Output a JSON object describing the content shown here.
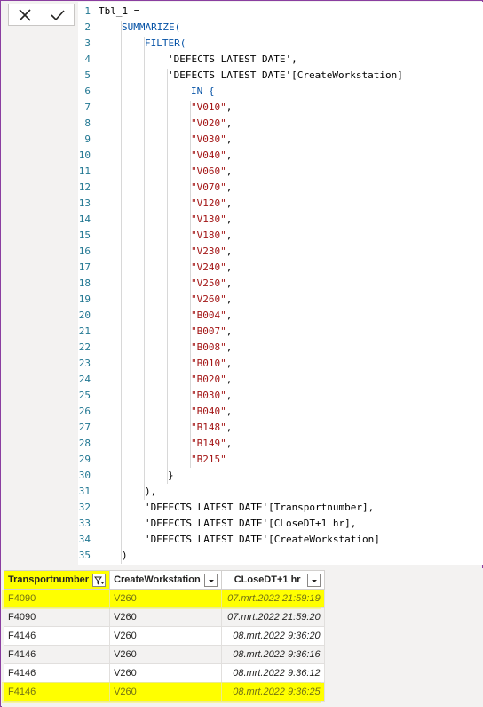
{
  "formula_bar": {
    "cancel_icon": "close-icon",
    "commit_icon": "checkmark-icon"
  },
  "editor": {
    "lines": [
      {
        "n": "1",
        "indent": 0,
        "parts": [
          {
            "t": "Tbl_1 =",
            "c": "plain"
          }
        ]
      },
      {
        "n": "2",
        "indent": 1,
        "parts": [
          {
            "t": "SUMMARIZE(",
            "c": "kw"
          }
        ]
      },
      {
        "n": "3",
        "indent": 2,
        "parts": [
          {
            "t": "FILTER(",
            "c": "kw"
          }
        ]
      },
      {
        "n": "4",
        "indent": 3,
        "parts": [
          {
            "t": "'DEFECTS LATEST DATE',",
            "c": "plain"
          }
        ]
      },
      {
        "n": "5",
        "indent": 3,
        "parts": [
          {
            "t": "'DEFECTS LATEST DATE'[CreateWorkstation]",
            "c": "plain"
          }
        ]
      },
      {
        "n": "6",
        "indent": 4,
        "parts": [
          {
            "t": "IN {",
            "c": "kw"
          }
        ]
      },
      {
        "n": "7",
        "indent": 4,
        "parts": [
          {
            "t": "\"V010\"",
            "c": "str"
          },
          {
            "t": ",",
            "c": "plain"
          }
        ]
      },
      {
        "n": "8",
        "indent": 4,
        "parts": [
          {
            "t": "\"V020\"",
            "c": "str"
          },
          {
            "t": ",",
            "c": "plain"
          }
        ]
      },
      {
        "n": "9",
        "indent": 4,
        "parts": [
          {
            "t": "\"V030\"",
            "c": "str"
          },
          {
            "t": ",",
            "c": "plain"
          }
        ]
      },
      {
        "n": "10",
        "indent": 4,
        "parts": [
          {
            "t": "\"V040\"",
            "c": "str"
          },
          {
            "t": ",",
            "c": "plain"
          }
        ]
      },
      {
        "n": "11",
        "indent": 4,
        "parts": [
          {
            "t": "\"V060\"",
            "c": "str"
          },
          {
            "t": ",",
            "c": "plain"
          }
        ]
      },
      {
        "n": "12",
        "indent": 4,
        "parts": [
          {
            "t": "\"V070\"",
            "c": "str"
          },
          {
            "t": ",",
            "c": "plain"
          }
        ]
      },
      {
        "n": "13",
        "indent": 4,
        "parts": [
          {
            "t": "\"V120\"",
            "c": "str"
          },
          {
            "t": ",",
            "c": "plain"
          }
        ]
      },
      {
        "n": "14",
        "indent": 4,
        "parts": [
          {
            "t": "\"V130\"",
            "c": "str"
          },
          {
            "t": ",",
            "c": "plain"
          }
        ]
      },
      {
        "n": "15",
        "indent": 4,
        "parts": [
          {
            "t": "\"V180\"",
            "c": "str"
          },
          {
            "t": ",",
            "c": "plain"
          }
        ]
      },
      {
        "n": "16",
        "indent": 4,
        "parts": [
          {
            "t": "\"V230\"",
            "c": "str"
          },
          {
            "t": ",",
            "c": "plain"
          }
        ]
      },
      {
        "n": "17",
        "indent": 4,
        "parts": [
          {
            "t": "\"V240\"",
            "c": "str"
          },
          {
            "t": ",",
            "c": "plain"
          }
        ]
      },
      {
        "n": "18",
        "indent": 4,
        "parts": [
          {
            "t": "\"V250\"",
            "c": "str"
          },
          {
            "t": ",",
            "c": "plain"
          }
        ]
      },
      {
        "n": "19",
        "indent": 4,
        "parts": [
          {
            "t": "\"V260\"",
            "c": "str"
          },
          {
            "t": ",",
            "c": "plain"
          }
        ]
      },
      {
        "n": "20",
        "indent": 4,
        "parts": [
          {
            "t": "\"B004\"",
            "c": "str"
          },
          {
            "t": ",",
            "c": "plain"
          }
        ]
      },
      {
        "n": "21",
        "indent": 4,
        "parts": [
          {
            "t": "\"B007\"",
            "c": "str"
          },
          {
            "t": ",",
            "c": "plain"
          }
        ]
      },
      {
        "n": "22",
        "indent": 4,
        "parts": [
          {
            "t": "\"B008\"",
            "c": "str"
          },
          {
            "t": ",",
            "c": "plain"
          }
        ]
      },
      {
        "n": "23",
        "indent": 4,
        "parts": [
          {
            "t": "\"B010\"",
            "c": "str"
          },
          {
            "t": ",",
            "c": "plain"
          }
        ]
      },
      {
        "n": "24",
        "indent": 4,
        "parts": [
          {
            "t": "\"B020\"",
            "c": "str"
          },
          {
            "t": ",",
            "c": "plain"
          }
        ]
      },
      {
        "n": "25",
        "indent": 4,
        "parts": [
          {
            "t": "\"B030\"",
            "c": "str"
          },
          {
            "t": ",",
            "c": "plain"
          }
        ]
      },
      {
        "n": "26",
        "indent": 4,
        "parts": [
          {
            "t": "\"B040\"",
            "c": "str"
          },
          {
            "t": ",",
            "c": "plain"
          }
        ]
      },
      {
        "n": "27",
        "indent": 4,
        "parts": [
          {
            "t": "\"B148\"",
            "c": "str"
          },
          {
            "t": ",",
            "c": "plain"
          }
        ]
      },
      {
        "n": "28",
        "indent": 4,
        "parts": [
          {
            "t": "\"B149\"",
            "c": "str"
          },
          {
            "t": ",",
            "c": "plain"
          }
        ]
      },
      {
        "n": "29",
        "indent": 4,
        "parts": [
          {
            "t": "\"B215\"",
            "c": "str"
          }
        ]
      },
      {
        "n": "30",
        "indent": 3,
        "parts": [
          {
            "t": "}",
            "c": "plain"
          }
        ]
      },
      {
        "n": "31",
        "indent": 2,
        "parts": [
          {
            "t": "),",
            "c": "plain"
          }
        ]
      },
      {
        "n": "32",
        "indent": 2,
        "parts": [
          {
            "t": "'DEFECTS LATEST DATE'[Transportnumber],",
            "c": "plain"
          }
        ]
      },
      {
        "n": "33",
        "indent": 2,
        "parts": [
          {
            "t": "'DEFECTS LATEST DATE'[CLoseDT+1 hr],",
            "c": "plain"
          }
        ]
      },
      {
        "n": "34",
        "indent": 2,
        "parts": [
          {
            "t": "'DEFECTS LATEST DATE'[CreateWorkstation]",
            "c": "plain"
          }
        ]
      },
      {
        "n": "35",
        "indent": 1,
        "parts": [
          {
            "t": ")",
            "c": "plain"
          }
        ]
      }
    ]
  },
  "table": {
    "columns": [
      {
        "label": "Transportnumber",
        "filter_icon": "filter-applied-icon"
      },
      {
        "label": "CreateWorkstation",
        "filter_icon": "dropdown-icon"
      },
      {
        "label": "CLoseDT+1 hr",
        "filter_icon": "dropdown-icon"
      }
    ],
    "rows": [
      {
        "transport": "F4090",
        "workstation": "V260",
        "close_dt": "07.mrt.2022 21:59:19",
        "highlighted": true
      },
      {
        "transport": "F4090",
        "workstation": "V260",
        "close_dt": "07.mrt.2022 21:59:20",
        "highlighted": false
      },
      {
        "transport": "F4146",
        "workstation": "V260",
        "close_dt": "08.mrt.2022 9:36:20",
        "highlighted": false
      },
      {
        "transport": "F4146",
        "workstation": "V260",
        "close_dt": "08.mrt.2022 9:36:16",
        "highlighted": false
      },
      {
        "transport": "F4146",
        "workstation": "V260",
        "close_dt": "08.mrt.2022 9:36:12",
        "highlighted": false
      },
      {
        "transport": "F4146",
        "workstation": "V260",
        "close_dt": "08.mrt.2022 9:36:25",
        "highlighted": true
      }
    ]
  },
  "colors": {
    "highlight": "#ffff00",
    "keyword": "#0451a5",
    "string": "#a31515",
    "line_number": "#237893",
    "frame_border": "#8a3ea0"
  }
}
